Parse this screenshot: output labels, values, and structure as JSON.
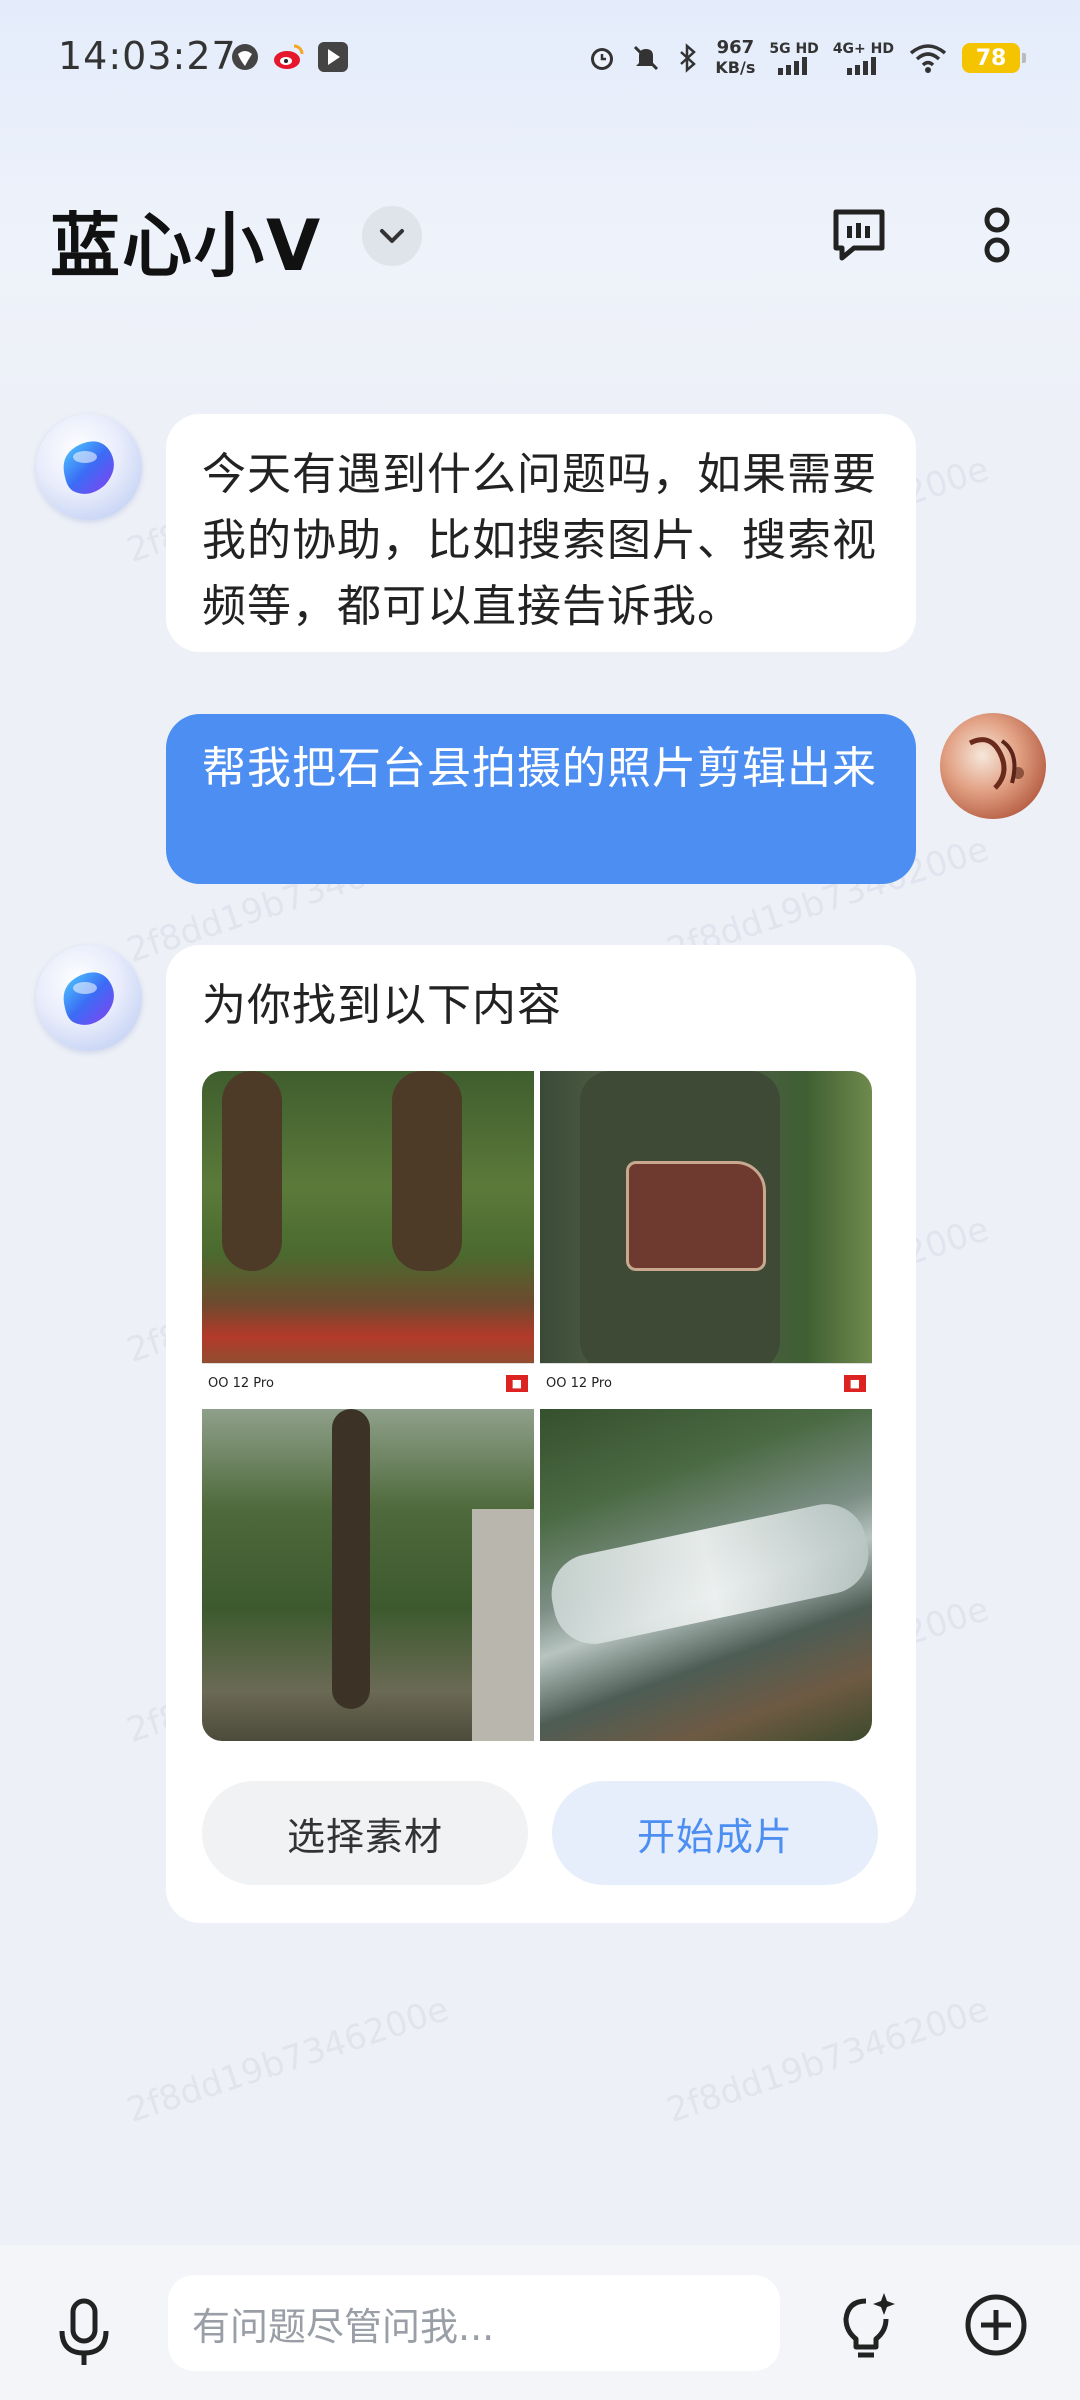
{
  "status_bar": {
    "time": "14:03:27",
    "net_speed_value": "967",
    "net_speed_unit": "KB/s",
    "sim1": "5G HD",
    "sim2": "4G+ HD",
    "battery": "78",
    "icons": [
      "browser-icon",
      "weibo-icon",
      "media-icon",
      "alarm-icon",
      "mute-icon",
      "bluetooth-icon",
      "wifi-icon"
    ]
  },
  "header": {
    "title": "蓝心小V",
    "icons": [
      "chevron-down-icon",
      "chat-history-icon",
      "more-options-icon"
    ]
  },
  "messages": [
    {
      "role": "bot",
      "text": "今天有遇到什么问题吗，如果需要我的协助，比如搜索图片、搜索视频等，都可以直接告诉我。"
    },
    {
      "role": "user",
      "text": "帮我把石台县拍摄的照片剪辑出来"
    },
    {
      "role": "bot",
      "text": "为你找到以下内容"
    }
  ],
  "photos": [
    {
      "caption": "OO 12 Pro"
    },
    {
      "caption": "OO 12 Pro"
    }
  ],
  "actions": {
    "select": "选择素材",
    "start": "开始成片"
  },
  "watermark": "2f8dd19b7346200e",
  "input": {
    "placeholder": "有问题尽管问我..."
  },
  "colors": {
    "accent": "#4c8ef2",
    "battery": "#f5c400"
  }
}
